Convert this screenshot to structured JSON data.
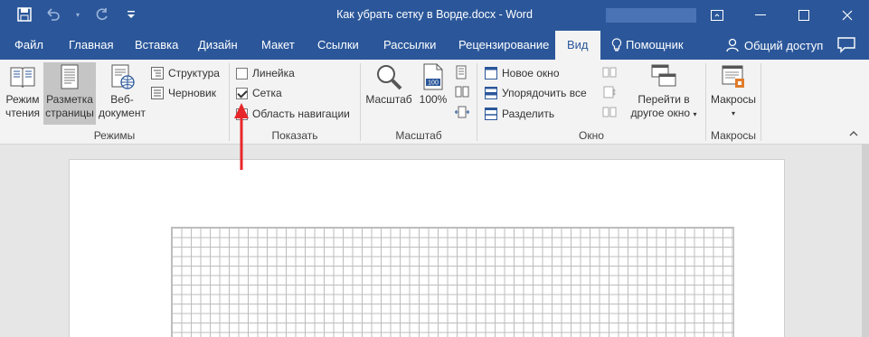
{
  "window": {
    "title": "Как убрать сетку в Ворде.docx - Word"
  },
  "tabs": [
    {
      "label": "Файл"
    },
    {
      "label": "Главная"
    },
    {
      "label": "Вставка"
    },
    {
      "label": "Дизайн"
    },
    {
      "label": "Макет"
    },
    {
      "label": "Ссылки"
    },
    {
      "label": "Рассылки"
    },
    {
      "label": "Рецензирование"
    },
    {
      "label": "Вид"
    },
    {
      "label": "Помощник"
    }
  ],
  "share_label": "Общий доступ",
  "groups": {
    "modes": {
      "label": "Режимы",
      "read_mode": [
        "Режим",
        "чтения"
      ],
      "print_layout": [
        "Разметка",
        "страницы"
      ],
      "web_layout": [
        "Веб-",
        "документ"
      ],
      "outline": "Структура",
      "draft": "Черновик"
    },
    "show": {
      "label": "Показать",
      "ruler": "Линейка",
      "gridlines": "Сетка",
      "nav_pane": "Область навигации"
    },
    "zoom": {
      "label": "Масштаб",
      "zoom": "Масштаб",
      "hundred": "100%",
      "icon_100": "100"
    },
    "window": {
      "label": "Окно",
      "new_window": "Новое окно",
      "arrange_all": "Упорядочить все",
      "split": "Разделить",
      "switch_windows": [
        "Перейти в",
        "другое окно"
      ]
    },
    "macros": {
      "label": "Макросы",
      "macros": "Макросы"
    }
  },
  "state": {
    "ruler_checked": false,
    "gridlines_checked": true,
    "nav_pane_checked": false
  },
  "colors": {
    "brand": "#2b579a",
    "ribbon": "#f3f3f3",
    "arrow": "#e8272a"
  }
}
